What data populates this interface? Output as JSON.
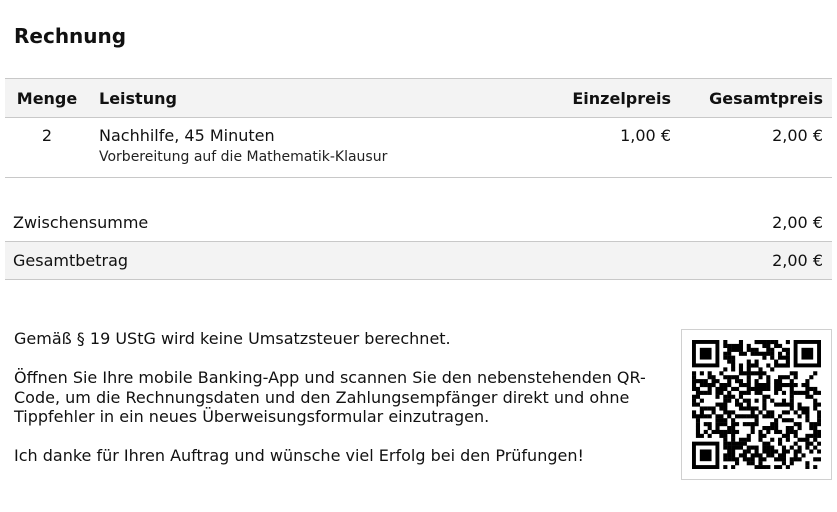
{
  "invoice": {
    "title": "Rechnung"
  },
  "table": {
    "headers": {
      "qty": "Menge",
      "description": "Leistung",
      "unit_price": "Einzelpreis",
      "total_price": "Gesamtpreis"
    },
    "rows": [
      {
        "qty": "2",
        "name": "Nachhilfe, 45 Minuten",
        "detail": "Vorbereitung auf die Mathematik-Klausur",
        "unit_price": "1,00 €",
        "total_price": "2,00 €"
      }
    ]
  },
  "totals": {
    "subtotal_label": "Zwischensumme",
    "subtotal_value": "2,00 €",
    "total_label": "Gesamtbetrag",
    "total_value": "2,00 €"
  },
  "notes": {
    "tax_note": "Gemäß § 19 UStG wird keine Umsatzsteuer berechnet.",
    "qr_instructions": "Öffnen Sie Ihre mobile Banking-App und scannen Sie den nebenstehenden QR-Code, um die Rechnungsdaten und den Zahlungsempfänger direkt und ohne Tippfehler in ein neues Überweisungsformular einzutragen.",
    "closing": "Ich danke für Ihren Auftrag und wünsche viel Erfolg bei den Prüfungen!"
  },
  "qr_code": {
    "icon": "qr-code-icon",
    "color": "#000000"
  }
}
